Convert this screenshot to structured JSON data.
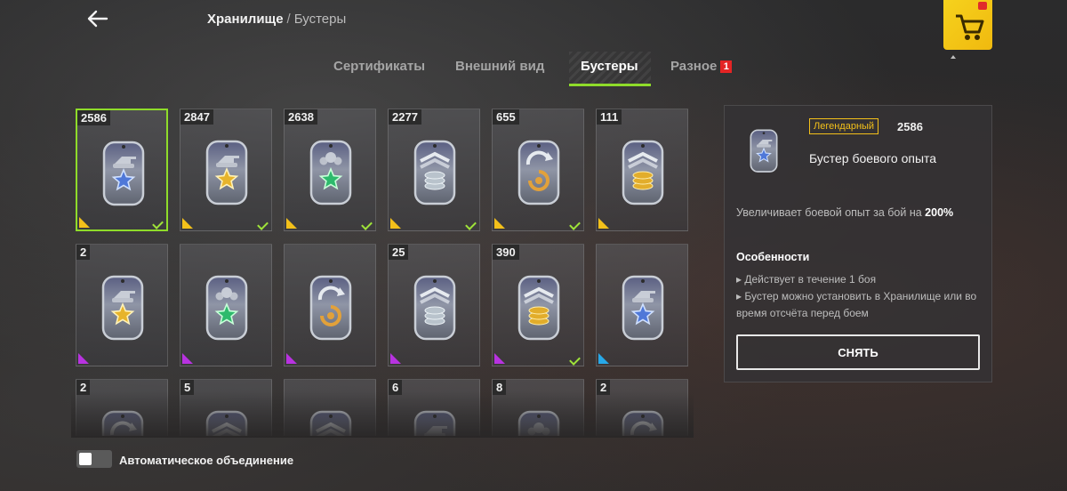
{
  "header": {
    "back_icon": "arrow-left-icon",
    "breadcrumb_main": "Хранилище",
    "breadcrumb_sep": "/",
    "breadcrumb_sub": "Бустеры",
    "shop_icon": "shopping-cart-icon"
  },
  "tabs": [
    {
      "label": "Сертификаты",
      "active": false
    },
    {
      "label": "Внешний вид",
      "active": false
    },
    {
      "label": "Бустеры",
      "active": true
    },
    {
      "label": "Разное",
      "active": false,
      "badge": "1"
    }
  ],
  "colors": {
    "accent_green": "#8fdc2a",
    "legendary": "#f3c01a",
    "epic": "#b832e0",
    "rare": "#27a8e8",
    "badge_red": "#e42424"
  },
  "boosters": [
    {
      "count": "2586",
      "icon": "blue-star-tank-icon",
      "rarity": "legendary",
      "checked": true,
      "selected": true
    },
    {
      "count": "2847",
      "icon": "gold-star-tank-icon",
      "rarity": "legendary",
      "checked": true
    },
    {
      "count": "2638",
      "icon": "green-star-crew-icon",
      "rarity": "legendary",
      "checked": true
    },
    {
      "count": "2277",
      "icon": "silver-coins-icon",
      "rarity": "legendary",
      "checked": true
    },
    {
      "count": "655",
      "icon": "gold-free-xp-icon",
      "rarity": "legendary",
      "checked": true
    },
    {
      "count": "111",
      "icon": "gold-coins-icon",
      "rarity": "legendary",
      "checked": false
    },
    {
      "count": "2",
      "icon": "gold-star-tank-icon",
      "rarity": "epic",
      "checked": false
    },
    {
      "count": "",
      "icon": "green-star-crew-icon",
      "rarity": "epic",
      "checked": false
    },
    {
      "count": "",
      "icon": "gold-free-xp-icon",
      "rarity": "epic",
      "checked": false
    },
    {
      "count": "25",
      "icon": "silver-coins-icon",
      "rarity": "epic",
      "checked": false
    },
    {
      "count": "390",
      "icon": "gold-coins-icon",
      "rarity": "epic",
      "checked": true
    },
    {
      "count": "",
      "icon": "blue-star-tank-icon",
      "rarity": "rare",
      "checked": false
    },
    {
      "count": "2",
      "icon": "gray-free-xp-icon",
      "rarity": "none",
      "checked": false
    },
    {
      "count": "5",
      "icon": "gray-coins-icon",
      "rarity": "none",
      "checked": false
    },
    {
      "count": "",
      "icon": "gray-coins-icon",
      "rarity": "none",
      "checked": false
    },
    {
      "count": "6",
      "icon": "gray-tank-icon",
      "rarity": "none",
      "checked": false
    },
    {
      "count": "8",
      "icon": "gray-crew-icon",
      "rarity": "none",
      "checked": false
    },
    {
      "count": "2",
      "icon": "gray-free-xp-icon",
      "rarity": "none",
      "checked": false
    }
  ],
  "auto_merge": {
    "label": "Автоматическое объединение",
    "enabled": false
  },
  "detail": {
    "icon": "blue-star-tank-icon",
    "rarity_label": "Легендарный",
    "count": "2586",
    "name": "Бустер боевого опыта",
    "desc_prefix": "Увеличивает боевой опыт за бой на ",
    "desc_value": "200%",
    "features_title": "Особенности",
    "features": [
      "Действует в течение 1 боя",
      "Бустер можно установить в Хранилище или во время отсчёта перед боем"
    ],
    "button_label": "СНЯТЬ"
  }
}
